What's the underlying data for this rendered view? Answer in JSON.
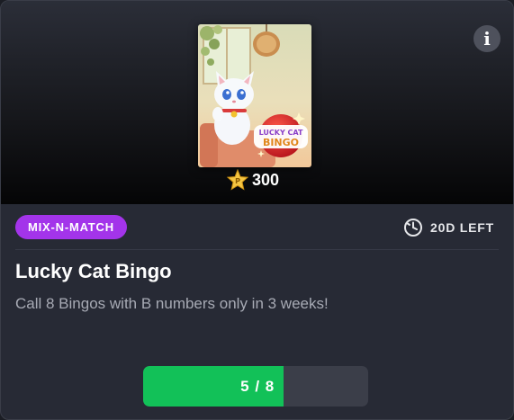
{
  "challenge": {
    "category_tag": "MIX-N-MATCH",
    "time_left": "20D LEFT",
    "title": "Lucky Cat Bingo",
    "description": "Call 8 Bingos with B numbers only in 3 weeks!",
    "reward": {
      "points": "300",
      "icon": "star-points-icon"
    },
    "thumbnail": {
      "logo_text_line1": "LUCKY CAT",
      "logo_text_line2": "BINGO"
    },
    "progress": {
      "label": "5 / 8",
      "current": 5,
      "total": 8
    },
    "info_button_label": "i"
  },
  "colors": {
    "tag_bg": "#a334ea",
    "progress_fill": "#12c158",
    "progress_track": "#3b3e49",
    "card_bg": "#272a35"
  }
}
